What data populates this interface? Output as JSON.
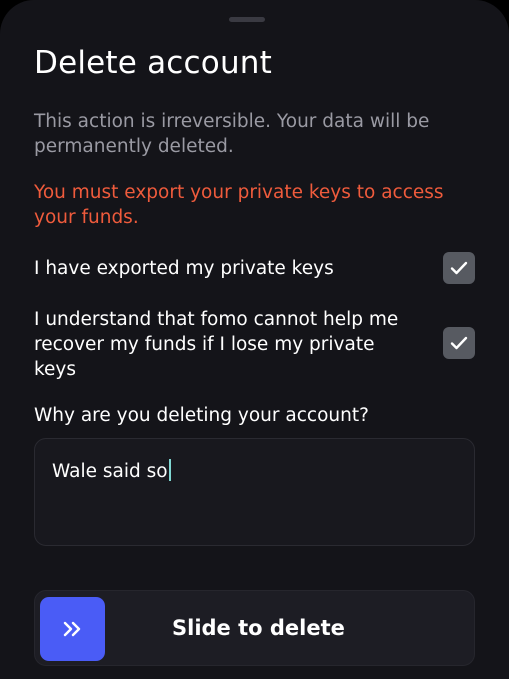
{
  "sheet": {
    "title": "Delete account",
    "description": "This action is irreversible. Your data will be permanently deleted.",
    "warning": "You must export your private keys to access your funds.",
    "warning_color": "#ef5b3c",
    "accent_color": "#4a5cf6"
  },
  "checks": [
    {
      "label": "I have exported my private keys",
      "checked": true,
      "icon": "checkmark-icon"
    },
    {
      "label": "I understand that fomo cannot help me recover my funds if I lose my private keys",
      "checked": true,
      "icon": "checkmark-icon"
    }
  ],
  "reason": {
    "question": "Why are you deleting your account?",
    "value": "Wale said so"
  },
  "slider": {
    "label": "Slide to delete",
    "icon": "double-chevron-right-icon"
  }
}
